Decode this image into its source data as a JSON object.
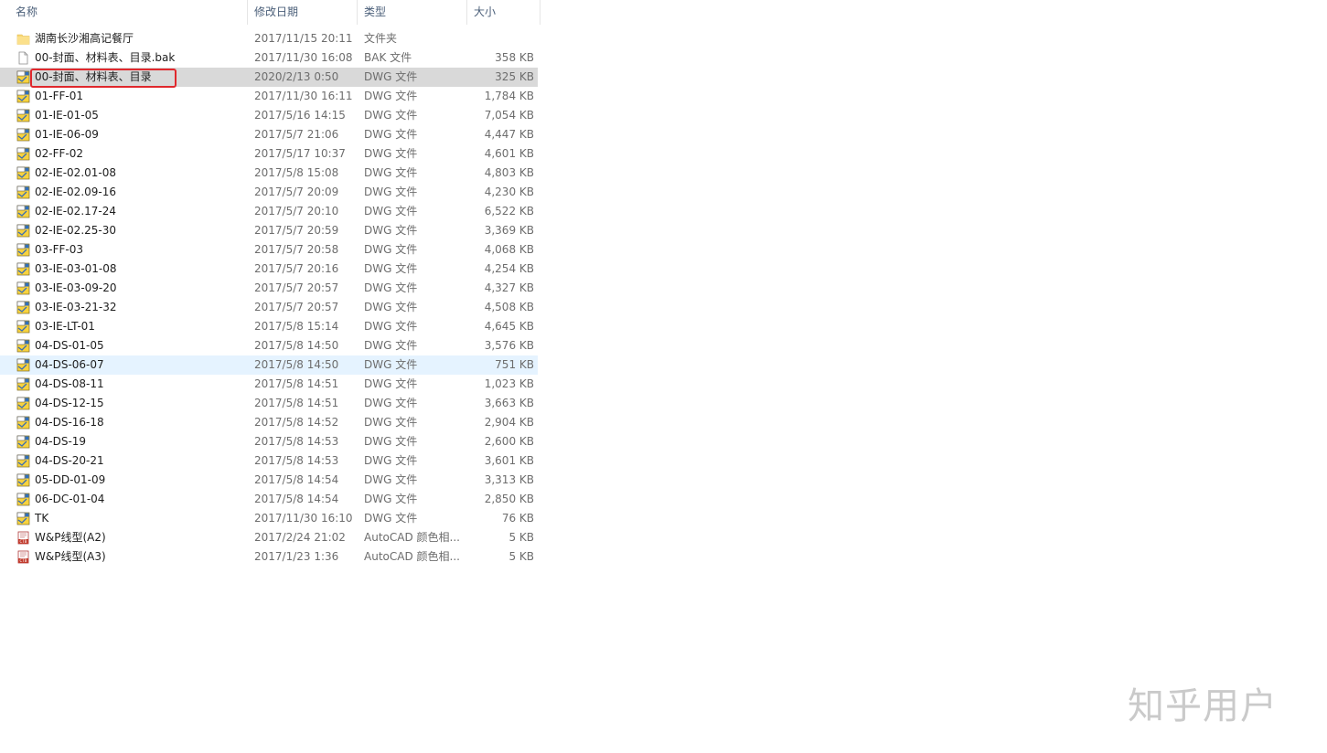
{
  "columns": {
    "name": "名称",
    "date": "修改日期",
    "type": "类型",
    "size": "大小"
  },
  "files": [
    {
      "name": "湖南长沙湘高记餐厅",
      "date": "2017/11/15 20:11",
      "type": "文件夹",
      "size": "",
      "icon": "folder-icon",
      "state": ""
    },
    {
      "name": "00-封面、材料表、目录.bak",
      "date": "2017/11/30 16:08",
      "type": "BAK 文件",
      "size": "358 KB",
      "icon": "bak-file-icon",
      "state": ""
    },
    {
      "name": "00-封面、材料表、目录",
      "date": "2020/2/13 0:50",
      "type": "DWG 文件",
      "size": "325 KB",
      "icon": "dwg-file-icon",
      "state": "selected"
    },
    {
      "name": "01-FF-01",
      "date": "2017/11/30 16:11",
      "type": "DWG 文件",
      "size": "1,784 KB",
      "icon": "dwg-file-icon",
      "state": ""
    },
    {
      "name": "01-IE-01-05",
      "date": "2017/5/16 14:15",
      "type": "DWG 文件",
      "size": "7,054 KB",
      "icon": "dwg-file-icon",
      "state": ""
    },
    {
      "name": "01-IE-06-09",
      "date": "2017/5/7 21:06",
      "type": "DWG 文件",
      "size": "4,447 KB",
      "icon": "dwg-file-icon",
      "state": ""
    },
    {
      "name": "02-FF-02",
      "date": "2017/5/17 10:37",
      "type": "DWG 文件",
      "size": "4,601 KB",
      "icon": "dwg-file-icon",
      "state": ""
    },
    {
      "name": "02-IE-02.01-08",
      "date": "2017/5/8 15:08",
      "type": "DWG 文件",
      "size": "4,803 KB",
      "icon": "dwg-file-icon",
      "state": ""
    },
    {
      "name": "02-IE-02.09-16",
      "date": "2017/5/7 20:09",
      "type": "DWG 文件",
      "size": "4,230 KB",
      "icon": "dwg-file-icon",
      "state": ""
    },
    {
      "name": "02-IE-02.17-24",
      "date": "2017/5/7 20:10",
      "type": "DWG 文件",
      "size": "6,522 KB",
      "icon": "dwg-file-icon",
      "state": ""
    },
    {
      "name": "02-IE-02.25-30",
      "date": "2017/5/7 20:59",
      "type": "DWG 文件",
      "size": "3,369 KB",
      "icon": "dwg-file-icon",
      "state": ""
    },
    {
      "name": "03-FF-03",
      "date": "2017/5/7 20:58",
      "type": "DWG 文件",
      "size": "4,068 KB",
      "icon": "dwg-file-icon",
      "state": ""
    },
    {
      "name": "03-IE-03-01-08",
      "date": "2017/5/7 20:16",
      "type": "DWG 文件",
      "size": "4,254 KB",
      "icon": "dwg-file-icon",
      "state": ""
    },
    {
      "name": "03-IE-03-09-20",
      "date": "2017/5/7 20:57",
      "type": "DWG 文件",
      "size": "4,327 KB",
      "icon": "dwg-file-icon",
      "state": ""
    },
    {
      "name": "03-IE-03-21-32",
      "date": "2017/5/7 20:57",
      "type": "DWG 文件",
      "size": "4,508 KB",
      "icon": "dwg-file-icon",
      "state": ""
    },
    {
      "name": "03-IE-LT-01",
      "date": "2017/5/8 15:14",
      "type": "DWG 文件",
      "size": "4,645 KB",
      "icon": "dwg-file-icon",
      "state": ""
    },
    {
      "name": "04-DS-01-05",
      "date": "2017/5/8 14:50",
      "type": "DWG 文件",
      "size": "3,576 KB",
      "icon": "dwg-file-icon",
      "state": ""
    },
    {
      "name": "04-DS-06-07",
      "date": "2017/5/8 14:50",
      "type": "DWG 文件",
      "size": "751 KB",
      "icon": "dwg-file-icon",
      "state": "hover"
    },
    {
      "name": "04-DS-08-11",
      "date": "2017/5/8 14:51",
      "type": "DWG 文件",
      "size": "1,023 KB",
      "icon": "dwg-file-icon",
      "state": ""
    },
    {
      "name": "04-DS-12-15",
      "date": "2017/5/8 14:51",
      "type": "DWG 文件",
      "size": "3,663 KB",
      "icon": "dwg-file-icon",
      "state": ""
    },
    {
      "name": "04-DS-16-18",
      "date": "2017/5/8 14:52",
      "type": "DWG 文件",
      "size": "2,904 KB",
      "icon": "dwg-file-icon",
      "state": ""
    },
    {
      "name": "04-DS-19",
      "date": "2017/5/8 14:53",
      "type": "DWG 文件",
      "size": "2,600 KB",
      "icon": "dwg-file-icon",
      "state": ""
    },
    {
      "name": "04-DS-20-21",
      "date": "2017/5/8 14:53",
      "type": "DWG 文件",
      "size": "3,601 KB",
      "icon": "dwg-file-icon",
      "state": ""
    },
    {
      "name": "05-DD-01-09",
      "date": "2017/5/8 14:54",
      "type": "DWG 文件",
      "size": "3,313 KB",
      "icon": "dwg-file-icon",
      "state": ""
    },
    {
      "name": "06-DC-01-04",
      "date": "2017/5/8 14:54",
      "type": "DWG 文件",
      "size": "2,850 KB",
      "icon": "dwg-file-icon",
      "state": ""
    },
    {
      "name": "TK",
      "date": "2017/11/30 16:10",
      "type": "DWG 文件",
      "size": "76 KB",
      "icon": "dwg-file-icon",
      "state": ""
    },
    {
      "name": "W&P线型(A2)",
      "date": "2017/2/24 21:02",
      "type": "AutoCAD 颜色相...",
      "size": "5 KB",
      "icon": "ctb-file-icon",
      "state": ""
    },
    {
      "name": "W&P线型(A3)",
      "date": "2017/1/23 1:36",
      "type": "AutoCAD 颜色相...",
      "size": "5 KB",
      "icon": "ctb-file-icon",
      "state": ""
    }
  ],
  "watermark": "知乎用户",
  "colors": {
    "selected_row": "#d9d9d9",
    "hover_row": "#e5f3ff",
    "highlight_box": "#e0282d",
    "header_text": "#4c607a"
  }
}
